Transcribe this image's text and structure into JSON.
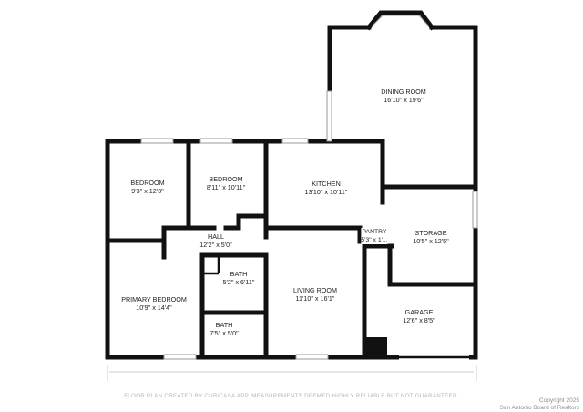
{
  "rooms": [
    {
      "name": "DINING ROOM",
      "dims": "16'10\" x 19'6\""
    },
    {
      "name": "BEDROOM",
      "dims": "9'3\" x 12'3\""
    },
    {
      "name": "BEDROOM",
      "dims": "8'11\" x 10'11\""
    },
    {
      "name": "KITCHEN",
      "dims": "13'10\" x 10'11\""
    },
    {
      "name": "HALL",
      "dims": "12'2\" x 5'0\""
    },
    {
      "name": "PANTRY",
      "dims": "5'3\" x 1'..."
    },
    {
      "name": "STORAGE",
      "dims": "10'5\" x 12'5\""
    },
    {
      "name": "BATH",
      "dims": "5'2\" x 6'11\""
    },
    {
      "name": "PRIMARY BEDROOM",
      "dims": "10'9\" x 14'4\""
    },
    {
      "name": "LIVING ROOM",
      "dims": "11'10\" x 16'1\""
    },
    {
      "name": "GARAGE",
      "dims": "12'6\" x 8'5\""
    },
    {
      "name": "BATH",
      "dims": "7'5\" x 5'0\""
    }
  ],
  "footer": {
    "disclaimer": "FLOOR PLAN CREATED BY CUBICASA APP. MEASUREMENTS DEEMED HIGHLY RELIABLE BUT NOT GUARANTEED.",
    "copyright_line1": "Copyright 2025",
    "copyright_line2": "San Antonio Board of Realtors"
  }
}
